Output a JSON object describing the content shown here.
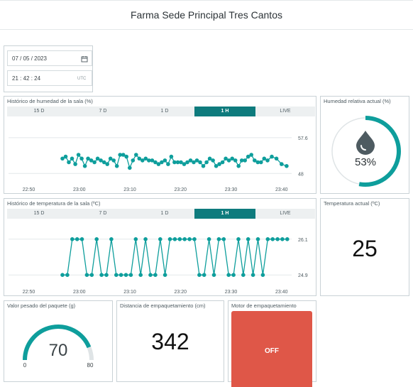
{
  "header": {
    "title": "Farma Sede Principal Tres Cantos"
  },
  "datetime": {
    "date": "07 / 05 / 2023",
    "time": "21 : 42 : 24",
    "tz": "UTC"
  },
  "time_tabs": [
    "15 D",
    "7 D",
    "1 D",
    "1 H",
    "LIVE"
  ],
  "active_tab": "1 H",
  "humidity_history": {
    "title": "Histórico de humedad de la sala (%)"
  },
  "temperature_history": {
    "title": "Histórico de temperatura de la sala (ºC)"
  },
  "humidity_now": {
    "title": "Humedad relativa actual (%)",
    "value": "53%",
    "fraction": 0.53
  },
  "temperature_now": {
    "title": "Temperatura actual (ºC)",
    "value": "25"
  },
  "package_weight": {
    "title": "Valor pesado del paquete (g)",
    "value": "70",
    "min": "0",
    "max": "80"
  },
  "packing_distance": {
    "title": "Distancia de empaquetamiento (cm)",
    "value": "342"
  },
  "packing_motor": {
    "title": "Motor de empaquetamiento",
    "state": "OFF"
  },
  "colors": {
    "accent": "#0e9e9c",
    "tab_active": "#0e7b7d",
    "off_button": "#df5748"
  },
  "chart_data": [
    {
      "type": "line",
      "title": "Histórico de humedad de la sala (%)",
      "x_ticks": [
        "22:50",
        "23:00",
        "23:10",
        "23:20",
        "23:30",
        "23:40"
      ],
      "x_range": [
        "22:46",
        "23:42"
      ],
      "y_ticks": [
        "57.6",
        "48"
      ],
      "ylim": [
        45,
        61
      ],
      "series": [
        {
          "x": [
            "22:56:40",
            "22:57:18",
            "22:57:56",
            "22:58:34",
            "22:59:12",
            "22:59:50",
            "23:00:28",
            "23:01:06",
            "23:01:44",
            "23:02:22",
            "23:03:00",
            "23:03:38",
            "23:04:16",
            "23:04:54",
            "23:05:32",
            "23:06:10",
            "23:06:48",
            "23:07:26",
            "23:08:04",
            "23:08:42",
            "23:09:20",
            "23:09:58",
            "23:10:36",
            "23:11:14",
            "23:11:52",
            "23:12:30",
            "23:13:08",
            "23:13:46",
            "23:14:24",
            "23:15:02",
            "23:15:40",
            "23:16:18",
            "23:16:56",
            "23:17:34",
            "23:18:12",
            "23:18:50",
            "23:19:28",
            "23:20:06",
            "23:20:44",
            "23:21:22",
            "23:22:00",
            "23:22:38",
            "23:23:16",
            "23:23:54",
            "23:24:32",
            "23:25:10",
            "23:25:48",
            "23:26:26",
            "23:27:04",
            "23:27:42",
            "23:28:20",
            "23:28:58",
            "23:29:36",
            "23:30:14",
            "23:30:52",
            "23:31:30",
            "23:32:08",
            "23:32:46",
            "23:33:24",
            "23:34:02",
            "23:34:40",
            "23:35:18",
            "23:35:56",
            "23:36:34",
            "23:37:14",
            "23:38:04",
            "23:39:00",
            "23:40:00",
            "23:41:00"
          ],
          "values": [
            52,
            52.5,
            51,
            52,
            50.5,
            53,
            52,
            50,
            52,
            51.5,
            51,
            52,
            51.5,
            51,
            50.5,
            52,
            51.5,
            50,
            53,
            53,
            52.5,
            49.5,
            51.5,
            53,
            52,
            51.5,
            52,
            51.5,
            51.5,
            51,
            50.5,
            51,
            51.5,
            50.5,
            52.5,
            51,
            51,
            51,
            50.5,
            51,
            51.5,
            51,
            51.5,
            51,
            50,
            51,
            52,
            51.5,
            50,
            50.5,
            51,
            52,
            51.5,
            52,
            51.5,
            50,
            51.5,
            51.5,
            52.5,
            53,
            51.5,
            51,
            51,
            52,
            51.5,
            52.5,
            52,
            50.5,
            50
          ]
        }
      ]
    },
    {
      "type": "line",
      "title": "Histórico de temperatura de la sala (ºC)",
      "x_ticks": [
        "22:50",
        "23:00",
        "23:10",
        "23:20",
        "23:30",
        "23:40"
      ],
      "x_range": [
        "22:46",
        "23:42"
      ],
      "y_ticks": [
        "26.1",
        "24.9"
      ],
      "ylim": [
        24.5,
        26.5
      ],
      "series": [
        {
          "x": [
            "22:56:40",
            "22:57:38",
            "22:58:36",
            "22:59:34",
            "23:00:32",
            "23:01:30",
            "23:02:28",
            "23:03:26",
            "23:04:24",
            "23:05:22",
            "23:06:20",
            "23:07:18",
            "23:08:16",
            "23:09:14",
            "23:10:12",
            "23:11:10",
            "23:12:08",
            "23:13:06",
            "23:14:04",
            "23:15:02",
            "23:16:00",
            "23:16:58",
            "23:17:56",
            "23:18:54",
            "23:19:52",
            "23:20:50",
            "23:21:48",
            "23:22:46",
            "23:23:44",
            "23:24:42",
            "23:25:40",
            "23:26:38",
            "23:27:36",
            "23:28:34",
            "23:29:32",
            "23:30:30",
            "23:31:28",
            "23:32:26",
            "23:33:24",
            "23:34:22",
            "23:35:20",
            "23:36:18",
            "23:37:16",
            "23:38:14",
            "23:39:12",
            "23:40:10",
            "23:41:08"
          ],
          "values": [
            24.9,
            24.9,
            26.1,
            26.1,
            26.1,
            24.9,
            24.9,
            26.1,
            24.9,
            24.9,
            26.1,
            24.9,
            24.9,
            24.9,
            24.9,
            26.1,
            24.9,
            26.1,
            24.9,
            24.9,
            26.1,
            24.9,
            26.1,
            26.1,
            26.1,
            26.1,
            26.1,
            26.1,
            24.9,
            24.9,
            26.1,
            24.9,
            26.1,
            26.1,
            24.9,
            24.9,
            26.1,
            24.9,
            26.1,
            24.9,
            26.1,
            24.9,
            26.1,
            26.1,
            26.1,
            26.1,
            26.1
          ]
        }
      ]
    }
  ]
}
